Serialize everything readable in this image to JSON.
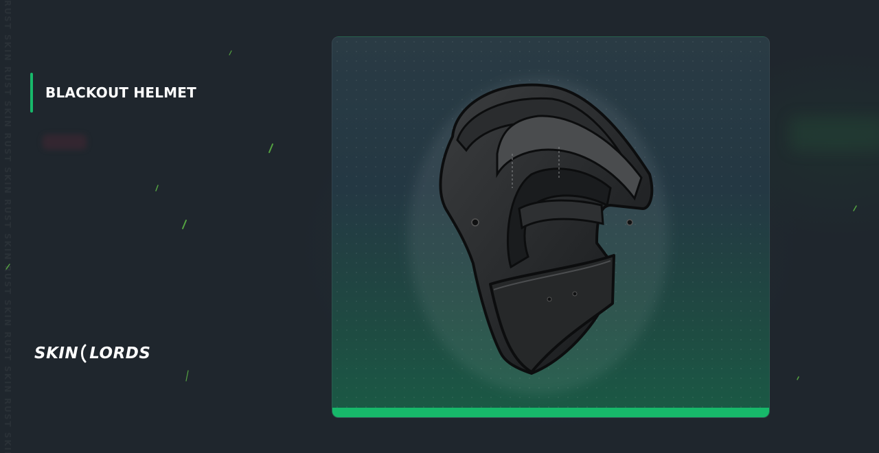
{
  "watermark": "RUST SKIN RUST SKIN RUST SKIN RUST SKIN RUST SKIN RUST SKIN RUST SKIN RUST SKIN RUST SKIN",
  "item": {
    "title": "BLACKOUT HELMET"
  },
  "brand": {
    "left": "SKIN",
    "right": "LORDS"
  },
  "colors": {
    "accent": "#17b86a",
    "background": "#1f262d",
    "card_top": "#2a3b44",
    "card_bottom": "#1a5a45"
  },
  "icons": {
    "logo": "skinlords-logo-icon",
    "item_image": "blackout-helmet-image"
  }
}
